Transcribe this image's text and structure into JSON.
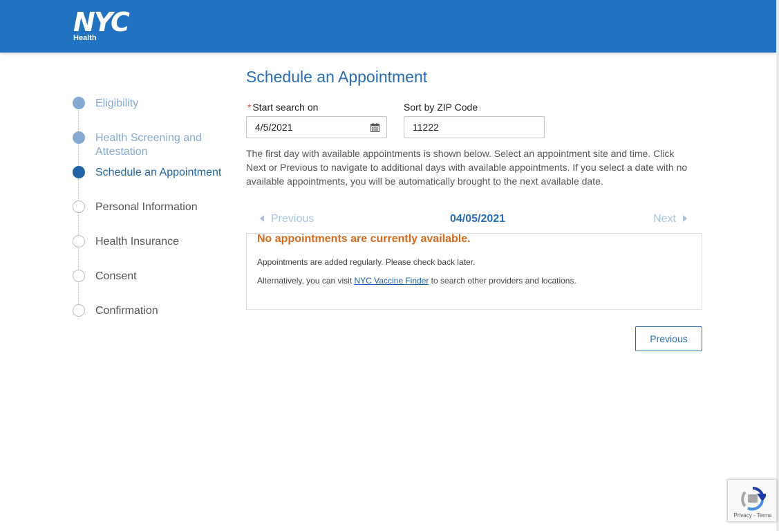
{
  "header": {
    "logo_main": "NYC",
    "logo_sub": "Health",
    "bg_color": "#2173c1"
  },
  "steps": [
    {
      "label": "Eligibility",
      "state": "done"
    },
    {
      "label": "Health Screening and Attestation",
      "state": "done"
    },
    {
      "label": "Schedule an Appointment",
      "state": "active"
    },
    {
      "label": "Personal Information",
      "state": "todo"
    },
    {
      "label": "Health Insurance",
      "state": "todo"
    },
    {
      "label": "Consent",
      "state": "todo"
    },
    {
      "label": "Confirmation",
      "state": "todo"
    }
  ],
  "main": {
    "title": "Schedule an Appointment",
    "start_label_required": "*",
    "start_label": "Start search on",
    "start_value": "4/5/2021",
    "zip_label": "Sort by ZIP Code",
    "zip_value": "11222",
    "description": "The first day with available appointments is shown below. Select an appointment site and time. Click Next or Previous to navigate to additional days with available appointments. If you select a date with no available appointments, you will be automatically brought to the next available date.",
    "nav": {
      "previous": "Previous",
      "date": "04/05/2021",
      "next": "Next"
    },
    "no_appointments": "No appointments are currently available.",
    "info_line1": "Appointments are added regularly. Please check back later.",
    "info_line2_prefix": "Alternatively, you can visit ",
    "info_line2_link": "NYC Vaccine Finder",
    "info_line2_suffix": " to search other providers and locations.",
    "previous_button": "Previous"
  },
  "recaptcha": {
    "text": "Privacy - Terms"
  }
}
